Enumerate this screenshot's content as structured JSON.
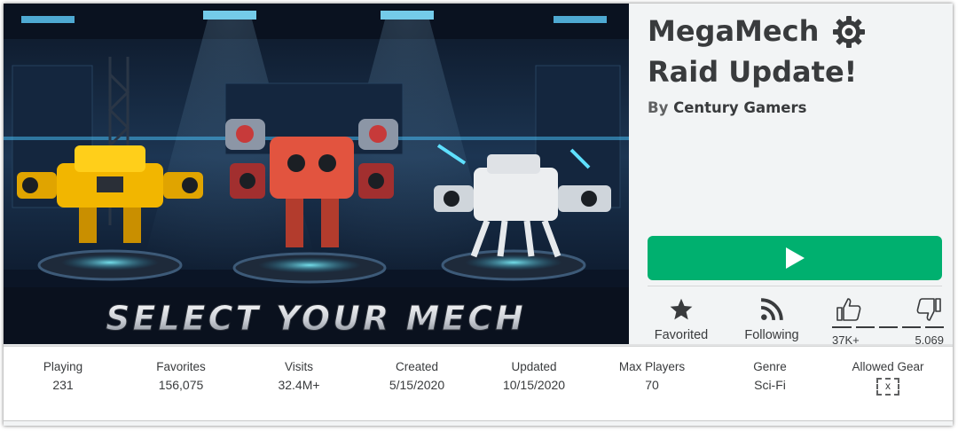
{
  "game": {
    "thumbnail_text": "SELECT YOUR MECH",
    "title_line1": "MegaMech",
    "title_line2": "Raid Update!",
    "creator_prefix": "By",
    "creator": "Century Gamers",
    "title_icon": "gear-icon"
  },
  "play_button": {
    "icon": "play-icon",
    "color": "#00b06f"
  },
  "actions": {
    "favorite_label": "Favorited",
    "follow_label": "Following"
  },
  "votes": {
    "up_count": "37K+",
    "down_count": "5,069"
  },
  "stats": [
    {
      "label": "Playing",
      "value": "231"
    },
    {
      "label": "Favorites",
      "value": "156,075"
    },
    {
      "label": "Visits",
      "value": "32.4M+"
    },
    {
      "label": "Created",
      "value": "5/15/2020"
    },
    {
      "label": "Updated",
      "value": "10/15/2020"
    },
    {
      "label": "Max Players",
      "value": "70"
    },
    {
      "label": "Genre",
      "value": "Sci-Fi"
    },
    {
      "label": "Allowed Gear",
      "value": "x"
    }
  ],
  "colors": {
    "accent": "#00b06f",
    "text": "#393b3d"
  }
}
